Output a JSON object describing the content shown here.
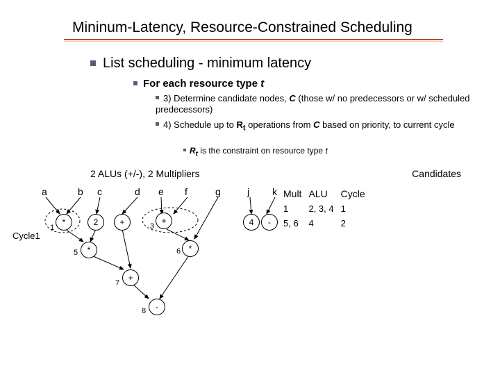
{
  "title": "Mininum-Latency, Resource-Constrained Scheduling",
  "l1": "List scheduling - minimum latency",
  "l2_prefix": "For each resource type ",
  "l2_var": "t",
  "l3a_prefix": "3) Determine candidate nodes, ",
  "l3a_C": "C",
  "l3a_rest": " (those w/ no predecessors or w/ scheduled predecessors)",
  "l3b_prefix": "4) Schedule up to ",
  "l3b_R": "R",
  "l3b_t": "t",
  "l3b_mid": " operations from ",
  "l3b_C": "C",
  "l3b_rest": " based on priority, to current cycle",
  "l4_R": "R",
  "l4_t": "t",
  "l4_rest": " is the constraint on resource type ",
  "l4_tvar": "t",
  "resources": "2 ALUs (+/-), 2 Multipliers",
  "candidates": "Candidates",
  "headers": {
    "a": "a",
    "b": "b",
    "c": "c",
    "d": "d",
    "e": "e",
    "f": "f",
    "g": "g",
    "j": "j",
    "k": "k"
  },
  "table": {
    "cols": {
      "mult": "Mult",
      "alu": "ALU",
      "cycle": "Cycle"
    },
    "rows": [
      {
        "mult": "1",
        "alu": "2, 3, 4",
        "cycle": "1"
      },
      {
        "mult": "5, 6",
        "alu": "4",
        "cycle": "2"
      }
    ]
  },
  "nodes": {
    "n1": "*",
    "n2": "2",
    "n3": "+",
    "n4": "+",
    "n5": "*",
    "n6": "*",
    "n7": "+",
    "n8": "-",
    "nj": "4",
    "nk": "-",
    "lbl1": "1",
    "lbl3": "3",
    "lbl5": "5",
    "lbl6": "6",
    "lbl7": "7",
    "lbl8": "8"
  },
  "cycle1": "Cycle1"
}
